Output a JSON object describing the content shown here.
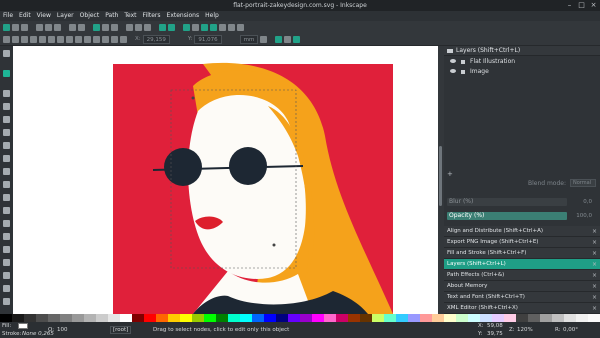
{
  "window": {
    "title": "flat-portrait-zakeydesign.com.svg - Inkscape",
    "controls": [
      "–",
      "□",
      "×"
    ]
  },
  "menu": [
    "File",
    "Edit",
    "View",
    "Layer",
    "Object",
    "Path",
    "Text",
    "Filters",
    "Extensions",
    "Help"
  ],
  "toolbar": {
    "x_label": "X:",
    "x_value": "29,159",
    "y_label": "Y:",
    "y_value": "91,076",
    "unit": "mm"
  },
  "layers_panel": {
    "title": "Layers (Shift+Ctrl+L)",
    "layers": [
      "Flat Illustration",
      "Image"
    ],
    "blend_label": "Blend mode:",
    "blend_value": "Normal",
    "blur_label": "Blur (%)",
    "blur_value": "0,0",
    "opacity_label": "Opacity (%)",
    "opacity_value": "100,0"
  },
  "dock": [
    {
      "label": "Align and Distribute (Shift+Ctrl+A)",
      "active": false
    },
    {
      "label": "Export PNG Image (Shift+Ctrl+E)",
      "active": false
    },
    {
      "label": "Fill and Stroke (Shift+Ctrl+F)",
      "active": false
    },
    {
      "label": "Layers (Shift+Ctrl+L)",
      "active": true
    },
    {
      "label": "Path Effects (Ctrl+&)",
      "active": false
    },
    {
      "label": "About Memory",
      "active": false
    },
    {
      "label": "Text and Font (Shift+Ctrl+T)",
      "active": false
    },
    {
      "label": "XML Editor (Shift+Ctrl+X)",
      "active": false
    }
  ],
  "status": {
    "fill_label": "Fill:",
    "stroke_label": "Stroke:",
    "stroke_value": "None 0,265",
    "opacity_label": "O:",
    "opacity_value": "100",
    "layer_value": "[root]",
    "message": "Drag to select nodes, click to edit only this object",
    "x_label": "X:",
    "x_value": "59,08",
    "y_label": "Y:",
    "y_value": "39,75",
    "zoom_label": "Z:",
    "zoom_value": "120%",
    "rotate_label": "R:",
    "rotate_value": "0,00°"
  },
  "colors": {
    "accent": "#1eb596",
    "background_red": "#e0203a",
    "hair_orange": "#f5a21b",
    "skin": "#fdfbf7",
    "glasses": "#1d2733",
    "lips": "#dd1f2c"
  },
  "palette": [
    "#000000",
    "#1a1a1a",
    "#333333",
    "#4d4d4d",
    "#666666",
    "#808080",
    "#999999",
    "#b3b3b3",
    "#cccccc",
    "#e6e6e6",
    "#ffffff",
    "#800000",
    "#ff0000",
    "#ff6600",
    "#ffcc00",
    "#ffff00",
    "#99cc00",
    "#00ff00",
    "#008000",
    "#00ffcc",
    "#00ffff",
    "#0066ff",
    "#0000ff",
    "#000080",
    "#6600ff",
    "#9900cc",
    "#ff00ff",
    "#ff66cc",
    "#cc0066",
    "#993300",
    "#663300",
    "#ccff66",
    "#66ffcc",
    "#33ccff",
    "#9999ff",
    "#ff9999",
    "#ffcc99",
    "#ffffcc",
    "#ccffcc",
    "#ccffff",
    "#cce0ff",
    "#e6ccff",
    "#ffcce6",
    "#404040",
    "#606060",
    "#a0a0a0",
    "#c0c0c0",
    "#e0e0e0",
    "#f0f0f0",
    "#fafafa"
  ]
}
